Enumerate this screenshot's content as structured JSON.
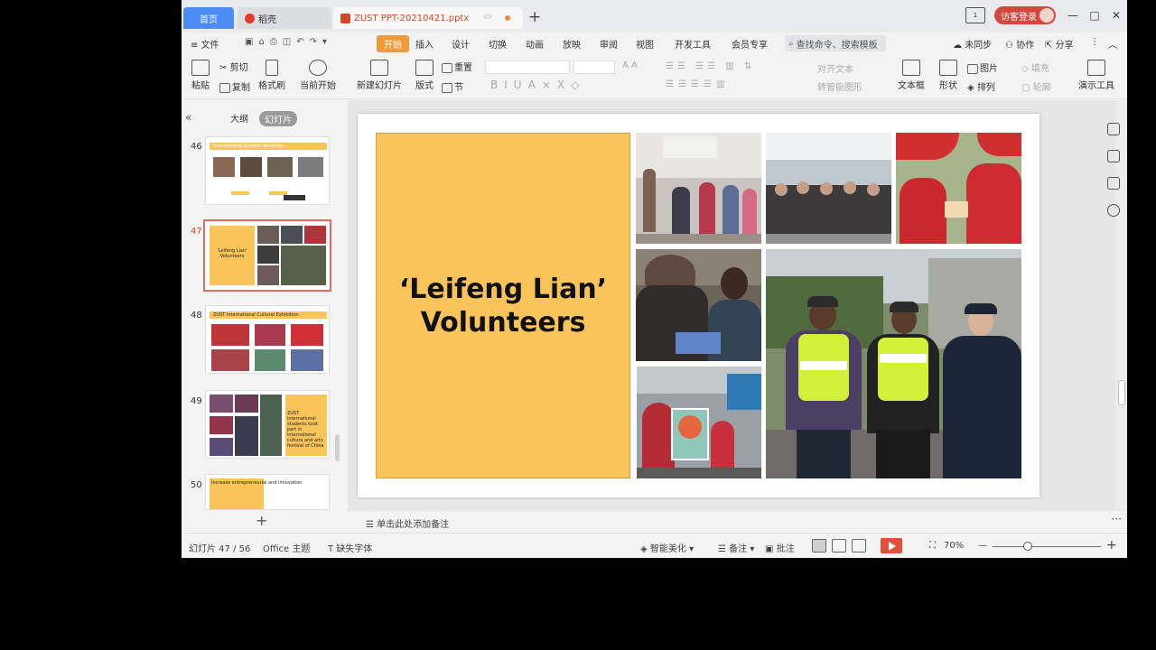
{
  "titlebar": {
    "tabs": [
      {
        "label": "首页"
      },
      {
        "label": "稻壳"
      },
      {
        "label": "ZUST PPT-20210421.pptx"
      }
    ],
    "new_tab": "+",
    "screen_icon_label": "1",
    "login": "访客登录",
    "minimize": "—",
    "maximize": "□",
    "close": "✕"
  },
  "menubar": {
    "file": "≡ 文件",
    "items": [
      "开始",
      "插入",
      "设计",
      "切换",
      "动画",
      "放映",
      "审阅",
      "视图",
      "开发工具",
      "会员专享"
    ],
    "search": "查找命令、搜索模板",
    "sync": "未同步",
    "collab": "协作",
    "share": "分享"
  },
  "ribbon": {
    "paste": "粘贴",
    "cut": "剪切",
    "copy": "复制",
    "format_painter": "格式刷",
    "start_from_current": "当前开始",
    "new_slide": "新建幻灯片",
    "layout": "版式",
    "section": "节",
    "reset": "重置",
    "bold": "B",
    "italic": "I",
    "underline": "U",
    "text_box": "文本框",
    "shape": "形状",
    "picture": "图片",
    "arrange": "排列",
    "slideshow_tools": "演示工具",
    "fill": "填充",
    "outline": "轮廓",
    "align_text": "对齐文本",
    "smart_art": "转智能图形"
  },
  "leftpanel": {
    "outline_tab": "大纲",
    "slides_tab": "幻灯片",
    "collapse": "«",
    "add": "+",
    "thumbs": [
      {
        "num": "46",
        "title": "International Student Activities"
      },
      {
        "num": "47",
        "title": "'Leifeng Lian' Volunteers"
      },
      {
        "num": "48",
        "title": "ZUST International Cultural Exhibition"
      },
      {
        "num": "49",
        "title": "ZUST international students took part in international culture and arts festival of China"
      },
      {
        "num": "50",
        "title": "Increase entrepreneurial and innovation"
      }
    ]
  },
  "slide": {
    "title_line1": "‘Leifeng Lian’",
    "title_line2": "Volunteers"
  },
  "notes": {
    "placeholder": "单击此处添加备注"
  },
  "status": {
    "slide_counter": "幻灯片 47 / 56",
    "theme": "Office 主题",
    "missing_font": "缺失字体",
    "beautify": "智能美化",
    "notes": "备注",
    "comments": "批注",
    "zoom": "70%",
    "zoom_minus": "—",
    "zoom_plus": "+"
  },
  "colors": {
    "accent_orange": "#f19b38",
    "slide_yellow": "#f9c55a",
    "tab_blue": "#4a8ef5",
    "login_red": "#d6473e",
    "play_red": "#e34e3a"
  }
}
